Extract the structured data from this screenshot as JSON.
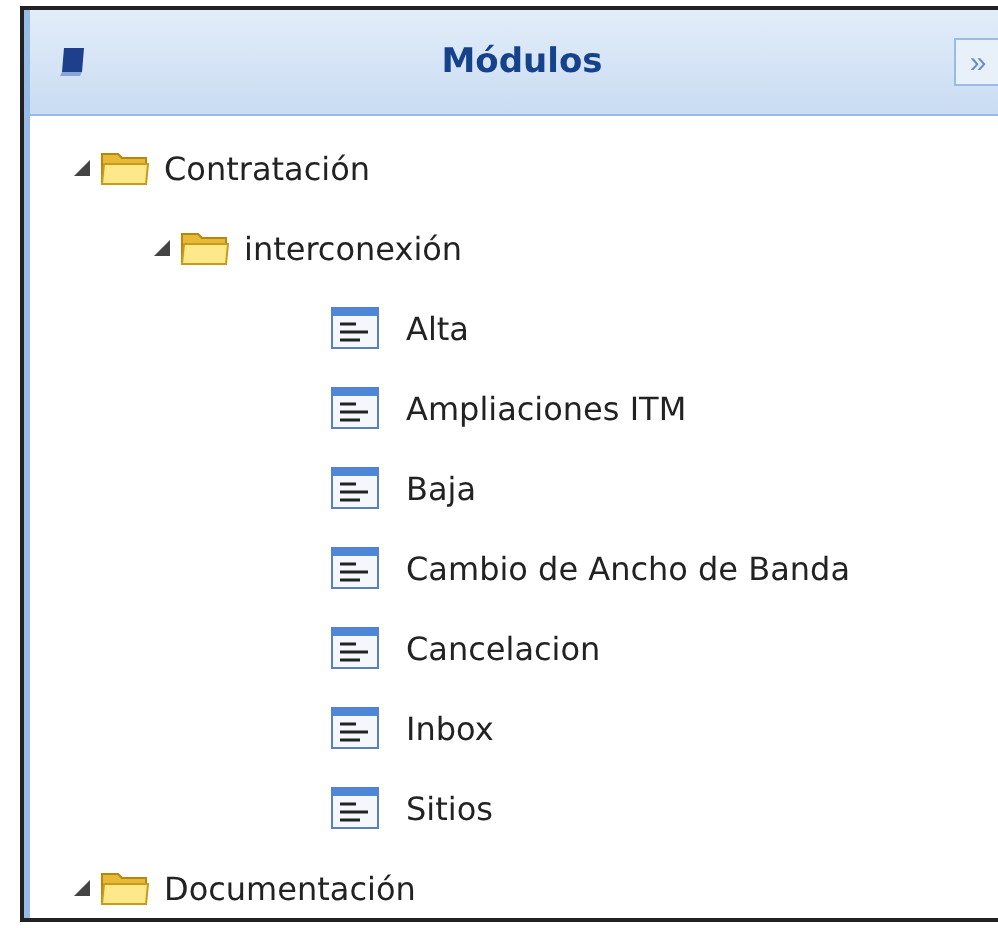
{
  "panel": {
    "title": "Módulos",
    "collapse_button": "»"
  },
  "tree": [
    {
      "label": "Contratación",
      "kind": "folder",
      "expanded": true,
      "children": [
        {
          "label": "interconexión",
          "kind": "folder",
          "expanded": true,
          "children": [
            {
              "label": "Alta",
              "kind": "form"
            },
            {
              "label": "Ampliaciones ITM",
              "kind": "form"
            },
            {
              "label": "Baja",
              "kind": "form"
            },
            {
              "label": "Cambio de Ancho de Banda",
              "kind": "form"
            },
            {
              "label": "Cancelacion",
              "kind": "form"
            },
            {
              "label": "Inbox",
              "kind": "form"
            },
            {
              "label": "Sitios",
              "kind": "form"
            }
          ]
        }
      ]
    },
    {
      "label": "Documentación",
      "kind": "folder",
      "expanded": true
    }
  ]
}
